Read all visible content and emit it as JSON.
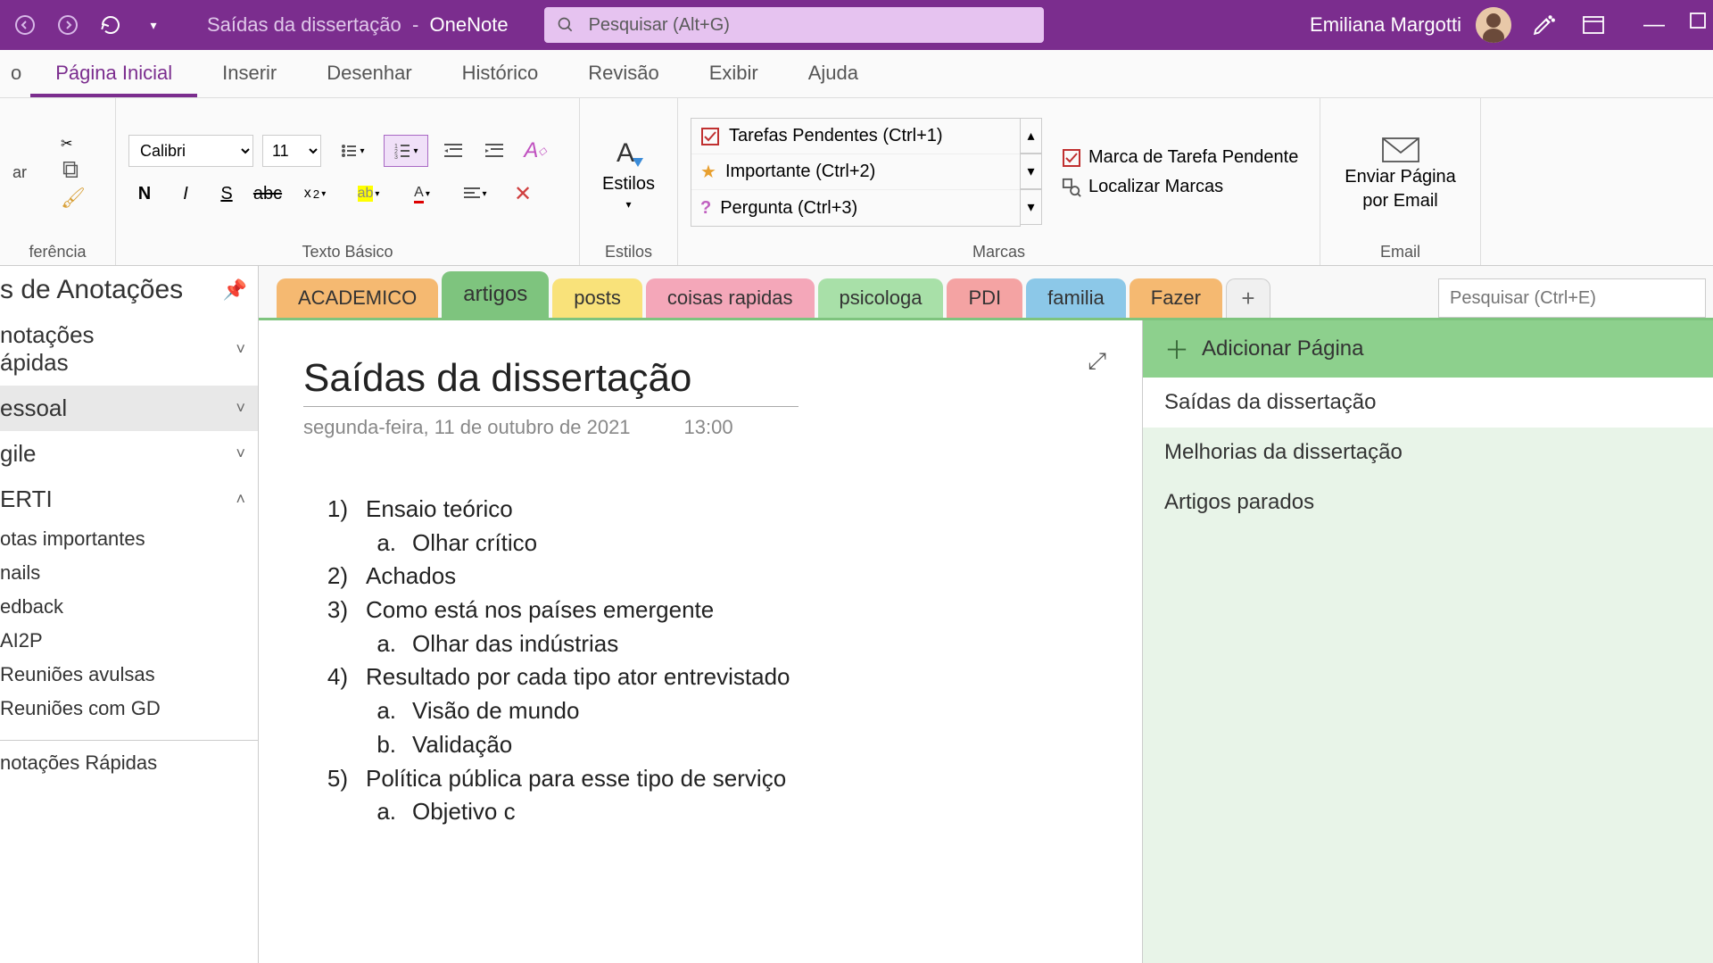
{
  "titlebar": {
    "doc_title": "Saídas da dissertação",
    "app_name": "OneNote",
    "search_placeholder": "Pesquisar (Alt+G)",
    "username": "Emiliana Margotti"
  },
  "ribbon_tabs": [
    "Página Inicial",
    "Inserir",
    "Desenhar",
    "Histórico",
    "Revisão",
    "Exibir",
    "Ajuda"
  ],
  "ribbon": {
    "clipboard_label": "ferência",
    "font_name": "Calibri",
    "font_size": "11",
    "text_label": "Texto Básico",
    "styles_label": "Estilos",
    "styles_btn": "Estilos",
    "tags": {
      "items": [
        {
          "label": "Tarefas Pendentes (Ctrl+1)"
        },
        {
          "label": "Importante (Ctrl+2)"
        },
        {
          "label": "Pergunta (Ctrl+3)"
        }
      ],
      "pending_mark": "Marca de Tarefa Pendente",
      "find_marks": "Localizar Marcas",
      "group_label": "Marcas"
    },
    "email": {
      "line1": "Enviar Página",
      "line2": "por Email",
      "group_label": "Email"
    }
  },
  "sidebar": {
    "header": "s de Anotações",
    "sections": [
      {
        "label": "notações\nápidas",
        "expanded": false
      },
      {
        "label": "essoal",
        "expanded": false,
        "selected": true
      },
      {
        "label": "gile",
        "expanded": false
      },
      {
        "label": "ERTI",
        "expanded": true,
        "children": [
          "otas importantes",
          "nails",
          "edback",
          "AI2P",
          "Reuniões avulsas",
          "Reuniões com GD"
        ]
      }
    ],
    "footer": "notações Rápidas"
  },
  "section_tabs": [
    {
      "label": "ACADEMICO",
      "cls": "tab-ACADEMICO"
    },
    {
      "label": "artigos",
      "cls": "tab-artigos",
      "active": true
    },
    {
      "label": "posts",
      "cls": "tab-posts"
    },
    {
      "label": "coisas rapidas",
      "cls": "tab-coisas"
    },
    {
      "label": "psicologa",
      "cls": "tab-psicologa"
    },
    {
      "label": "PDI",
      "cls": "tab-PDI"
    },
    {
      "label": "familia",
      "cls": "tab-familia"
    },
    {
      "label": "Fazer",
      "cls": "tab-Fazer"
    }
  ],
  "page_search_placeholder": "Pesquisar (Ctrl+E)",
  "note": {
    "title": "Saídas da dissertação",
    "date": "segunda-feira, 11 de outubro de 2021",
    "time": "13:00",
    "items": [
      {
        "n": "1)",
        "t": "Ensaio teórico",
        "sub": [
          {
            "n": "a.",
            "t": "Olhar crítico"
          }
        ]
      },
      {
        "n": "2)",
        "t": "Achados"
      },
      {
        "n": "3)",
        "t": "Como está nos países emergente",
        "sub": [
          {
            "n": "a.",
            "t": "Olhar das indústrias"
          }
        ]
      },
      {
        "n": "4)",
        "t": "Resultado por cada tipo ator entrevistado",
        "sub": [
          {
            "n": "a.",
            "t": "Visão de mundo"
          },
          {
            "n": "b.",
            "t": "Validação"
          }
        ]
      },
      {
        "n": "5)",
        "t": "Política pública para esse tipo de serviço",
        "sub": [
          {
            "n": "a.",
            "t": "Objetivo c"
          }
        ]
      }
    ]
  },
  "page_list": {
    "add_label": "Adicionar Página",
    "pages": [
      "Saídas da dissertação",
      "Melhorias da dissertação",
      "Artigos parados"
    ]
  }
}
